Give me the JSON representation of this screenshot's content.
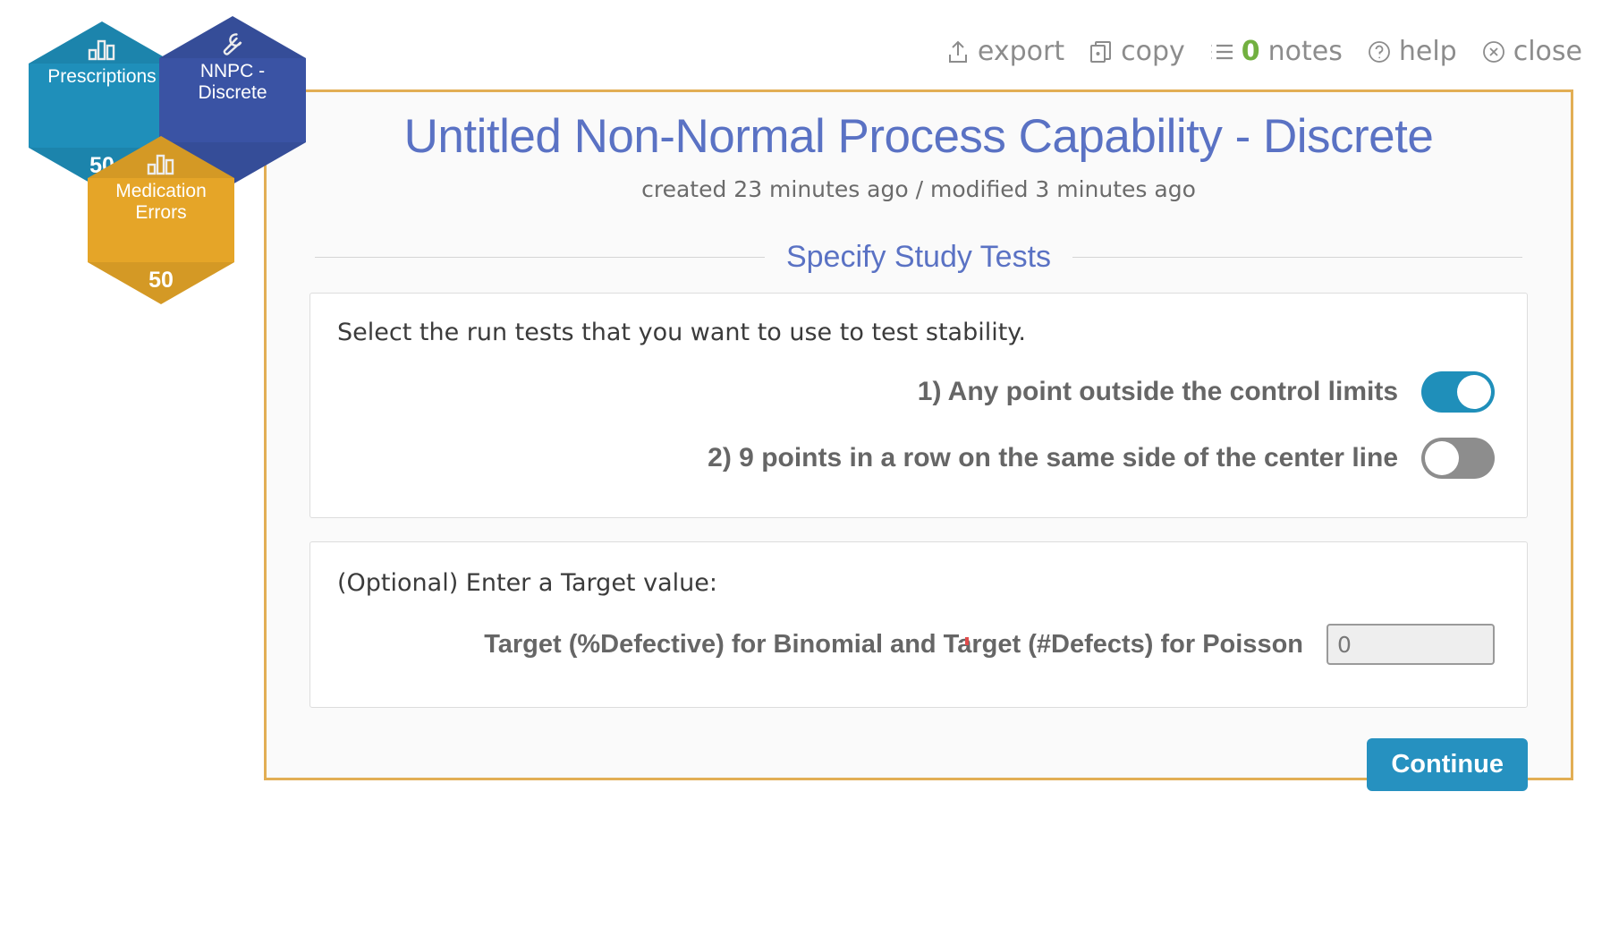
{
  "toolbar": {
    "items": [
      {
        "id": "export",
        "label": "export",
        "icon": "export-icon"
      },
      {
        "id": "copy",
        "label": "copy",
        "icon": "copy-icon"
      },
      {
        "id": "notes",
        "label": "notes",
        "count": "0",
        "icon": "notes-list-icon"
      },
      {
        "id": "help",
        "label": "help",
        "icon": "question-circle-icon"
      },
      {
        "id": "close",
        "label": "close",
        "icon": "close-circle-icon"
      }
    ],
    "notes_count_color": "#72b040"
  },
  "hexes": [
    {
      "id": "prescriptions",
      "title": "Prescriptions",
      "count": "50",
      "icon": "bar-chart-icon",
      "color": "#1f8fba"
    },
    {
      "id": "nnpc-discrete",
      "title": "NNPC - Discrete",
      "count": "",
      "icon": "wrench-icon",
      "color": "#3a53a4"
    },
    {
      "id": "medication-errors",
      "title": "Medication Errors",
      "count": "50",
      "icon": "bar-chart-icon",
      "color": "#e5a528"
    }
  ],
  "panel": {
    "title": "Untitled Non-Normal Process Capability - Discrete",
    "subtitle": "created 23 minutes ago / modified 3 minutes ago",
    "title_color": "#5a72c4",
    "border_color": "#e2ae54",
    "section_title": "Specify Study Tests"
  },
  "run_tests_card": {
    "intro": "Select the run tests that you want to use to test stability.",
    "tests": [
      {
        "label": "1) Any point outside the control limits",
        "on": true
      },
      {
        "label": "2) 9 points in a row on the same side of the center line",
        "on": false
      }
    ]
  },
  "target_card": {
    "intro": "(Optional) Enter a Target value:",
    "field_label": "Target (%Defective) for Binomial and Target (#Defects) for Poisson",
    "field_value": "0",
    "field_placeholder": "0"
  },
  "footer": {
    "continue_label": "Continue",
    "continue_color": "#2691c0"
  }
}
